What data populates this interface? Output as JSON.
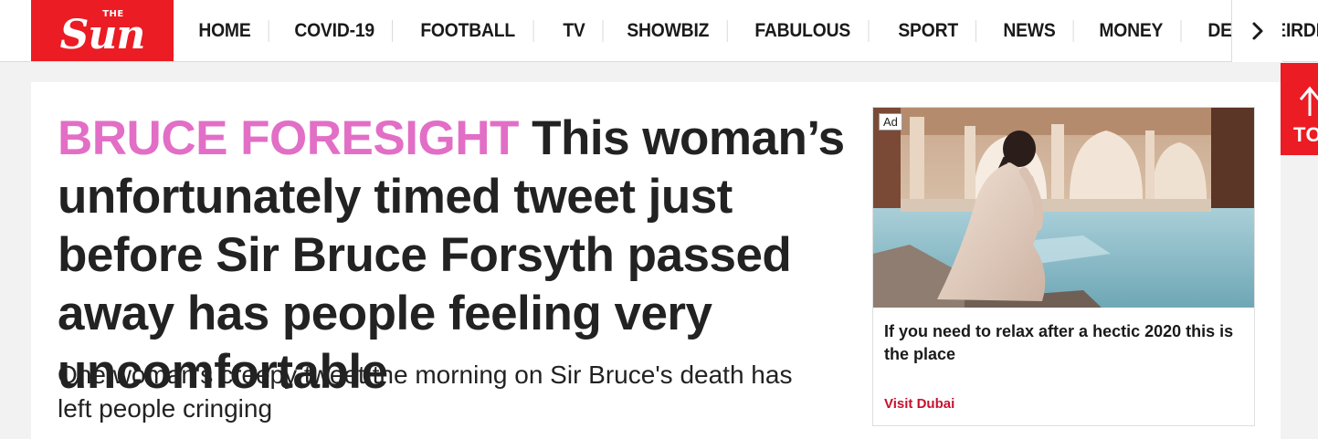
{
  "brand": {
    "logo_small": "THE",
    "logo_main": "Sun",
    "accent": "#eb1c24"
  },
  "nav": {
    "items": [
      "HOME",
      "COVID-19",
      "FOOTBALL",
      "TV",
      "SHOWBIZ",
      "FABULOUS",
      "SPORT",
      "NEWS",
      "MONEY",
      "DEAR DEIRDRE"
    ],
    "more_icon": "chevron-right-icon"
  },
  "article": {
    "kicker": "BRUCE FORESIGHT",
    "kicker_color": "#e26ec6",
    "headline": "This woman’s unfortunately timed tweet just before Sir Bruce Forsyth passed away has people feeling very uncomfortable",
    "standfirst": "One woman's creepy tweet the morning on Sir Bruce's death has left people cringing"
  },
  "ad": {
    "badge": "Ad",
    "title": "If you need to relax after a hectic 2020 this is the place",
    "sponsor": "Visit Dubai"
  },
  "back_to_top": {
    "label": "TOP",
    "icon": "arrow-up-icon"
  }
}
